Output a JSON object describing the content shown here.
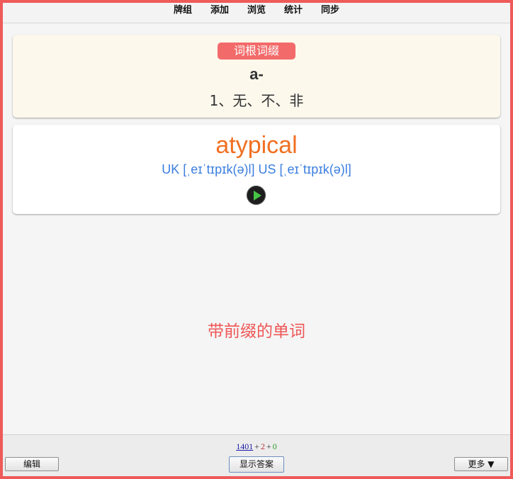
{
  "nav": {
    "items": [
      "牌组",
      "添加",
      "浏览",
      "统计",
      "同步"
    ]
  },
  "root_card": {
    "badge": "词根词缀",
    "affix": "a-",
    "meaning": "1、无、不、非"
  },
  "word_card": {
    "word": "atypical",
    "phonetic": "UK [ˌeɪˈtɪpɪk(ə)l] US [ˌeɪˈtɪpɪk(ə)l]",
    "play_icon": "play-icon"
  },
  "hint": "带前缀的单词",
  "footer": {
    "new_count": "1401",
    "plus1": "+",
    "learn_count": "2",
    "plus2": "+",
    "review_count": "0",
    "edit_label": "编辑",
    "show_answer_label": "显示答案",
    "more_label": "更多 ▼"
  },
  "colors": {
    "frame": "#ef5a5a",
    "badge": "#f36a6a",
    "headword": "#f07022",
    "phonetic": "#3a7ee0",
    "hint": "#ef5757"
  }
}
